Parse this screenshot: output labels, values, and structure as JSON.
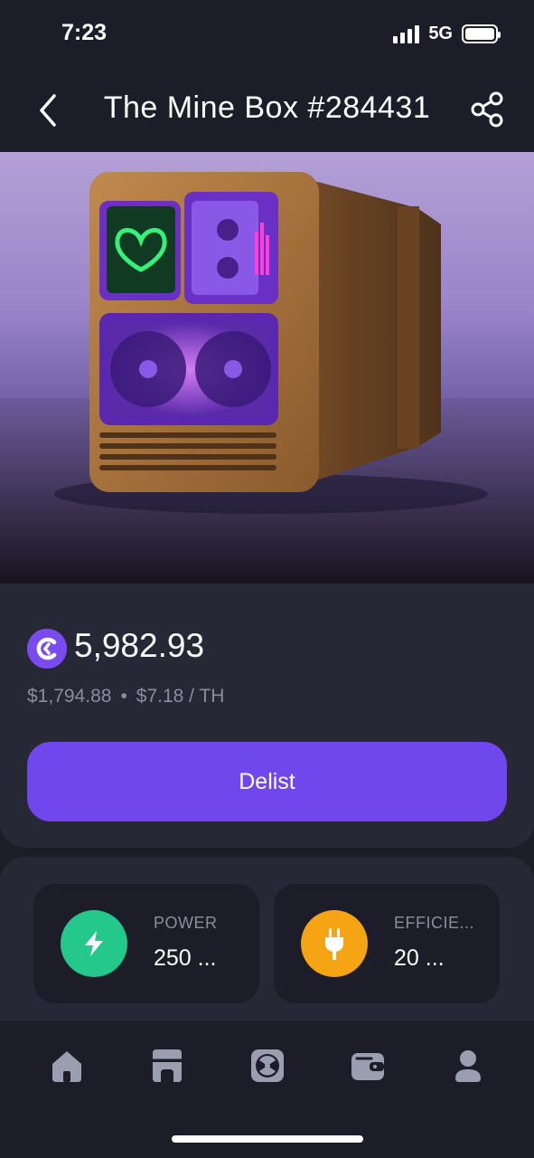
{
  "status_bar": {
    "time": "7:23",
    "network": "5G"
  },
  "header": {
    "title": "The Mine Box #284431"
  },
  "price": {
    "amount": "5,982.93",
    "usd": "$1,794.88",
    "separator": "•",
    "per_th": "$7.18 / TH"
  },
  "actions": {
    "delist_label": "Delist"
  },
  "stats": [
    {
      "label": "POWER",
      "value": "250 ...",
      "icon": "lightning-icon",
      "color": "#23c88a"
    },
    {
      "label": "EFFICIE...",
      "value": "20 ...",
      "icon": "plug-icon",
      "color": "#f5a413"
    }
  ],
  "tab_bar": {
    "items": [
      "home-icon",
      "store-icon",
      "miner-icon",
      "wallet-icon",
      "profile-icon"
    ]
  },
  "colors": {
    "accent": "#7047ec",
    "background": "#1c1d29",
    "card": "#262836"
  }
}
